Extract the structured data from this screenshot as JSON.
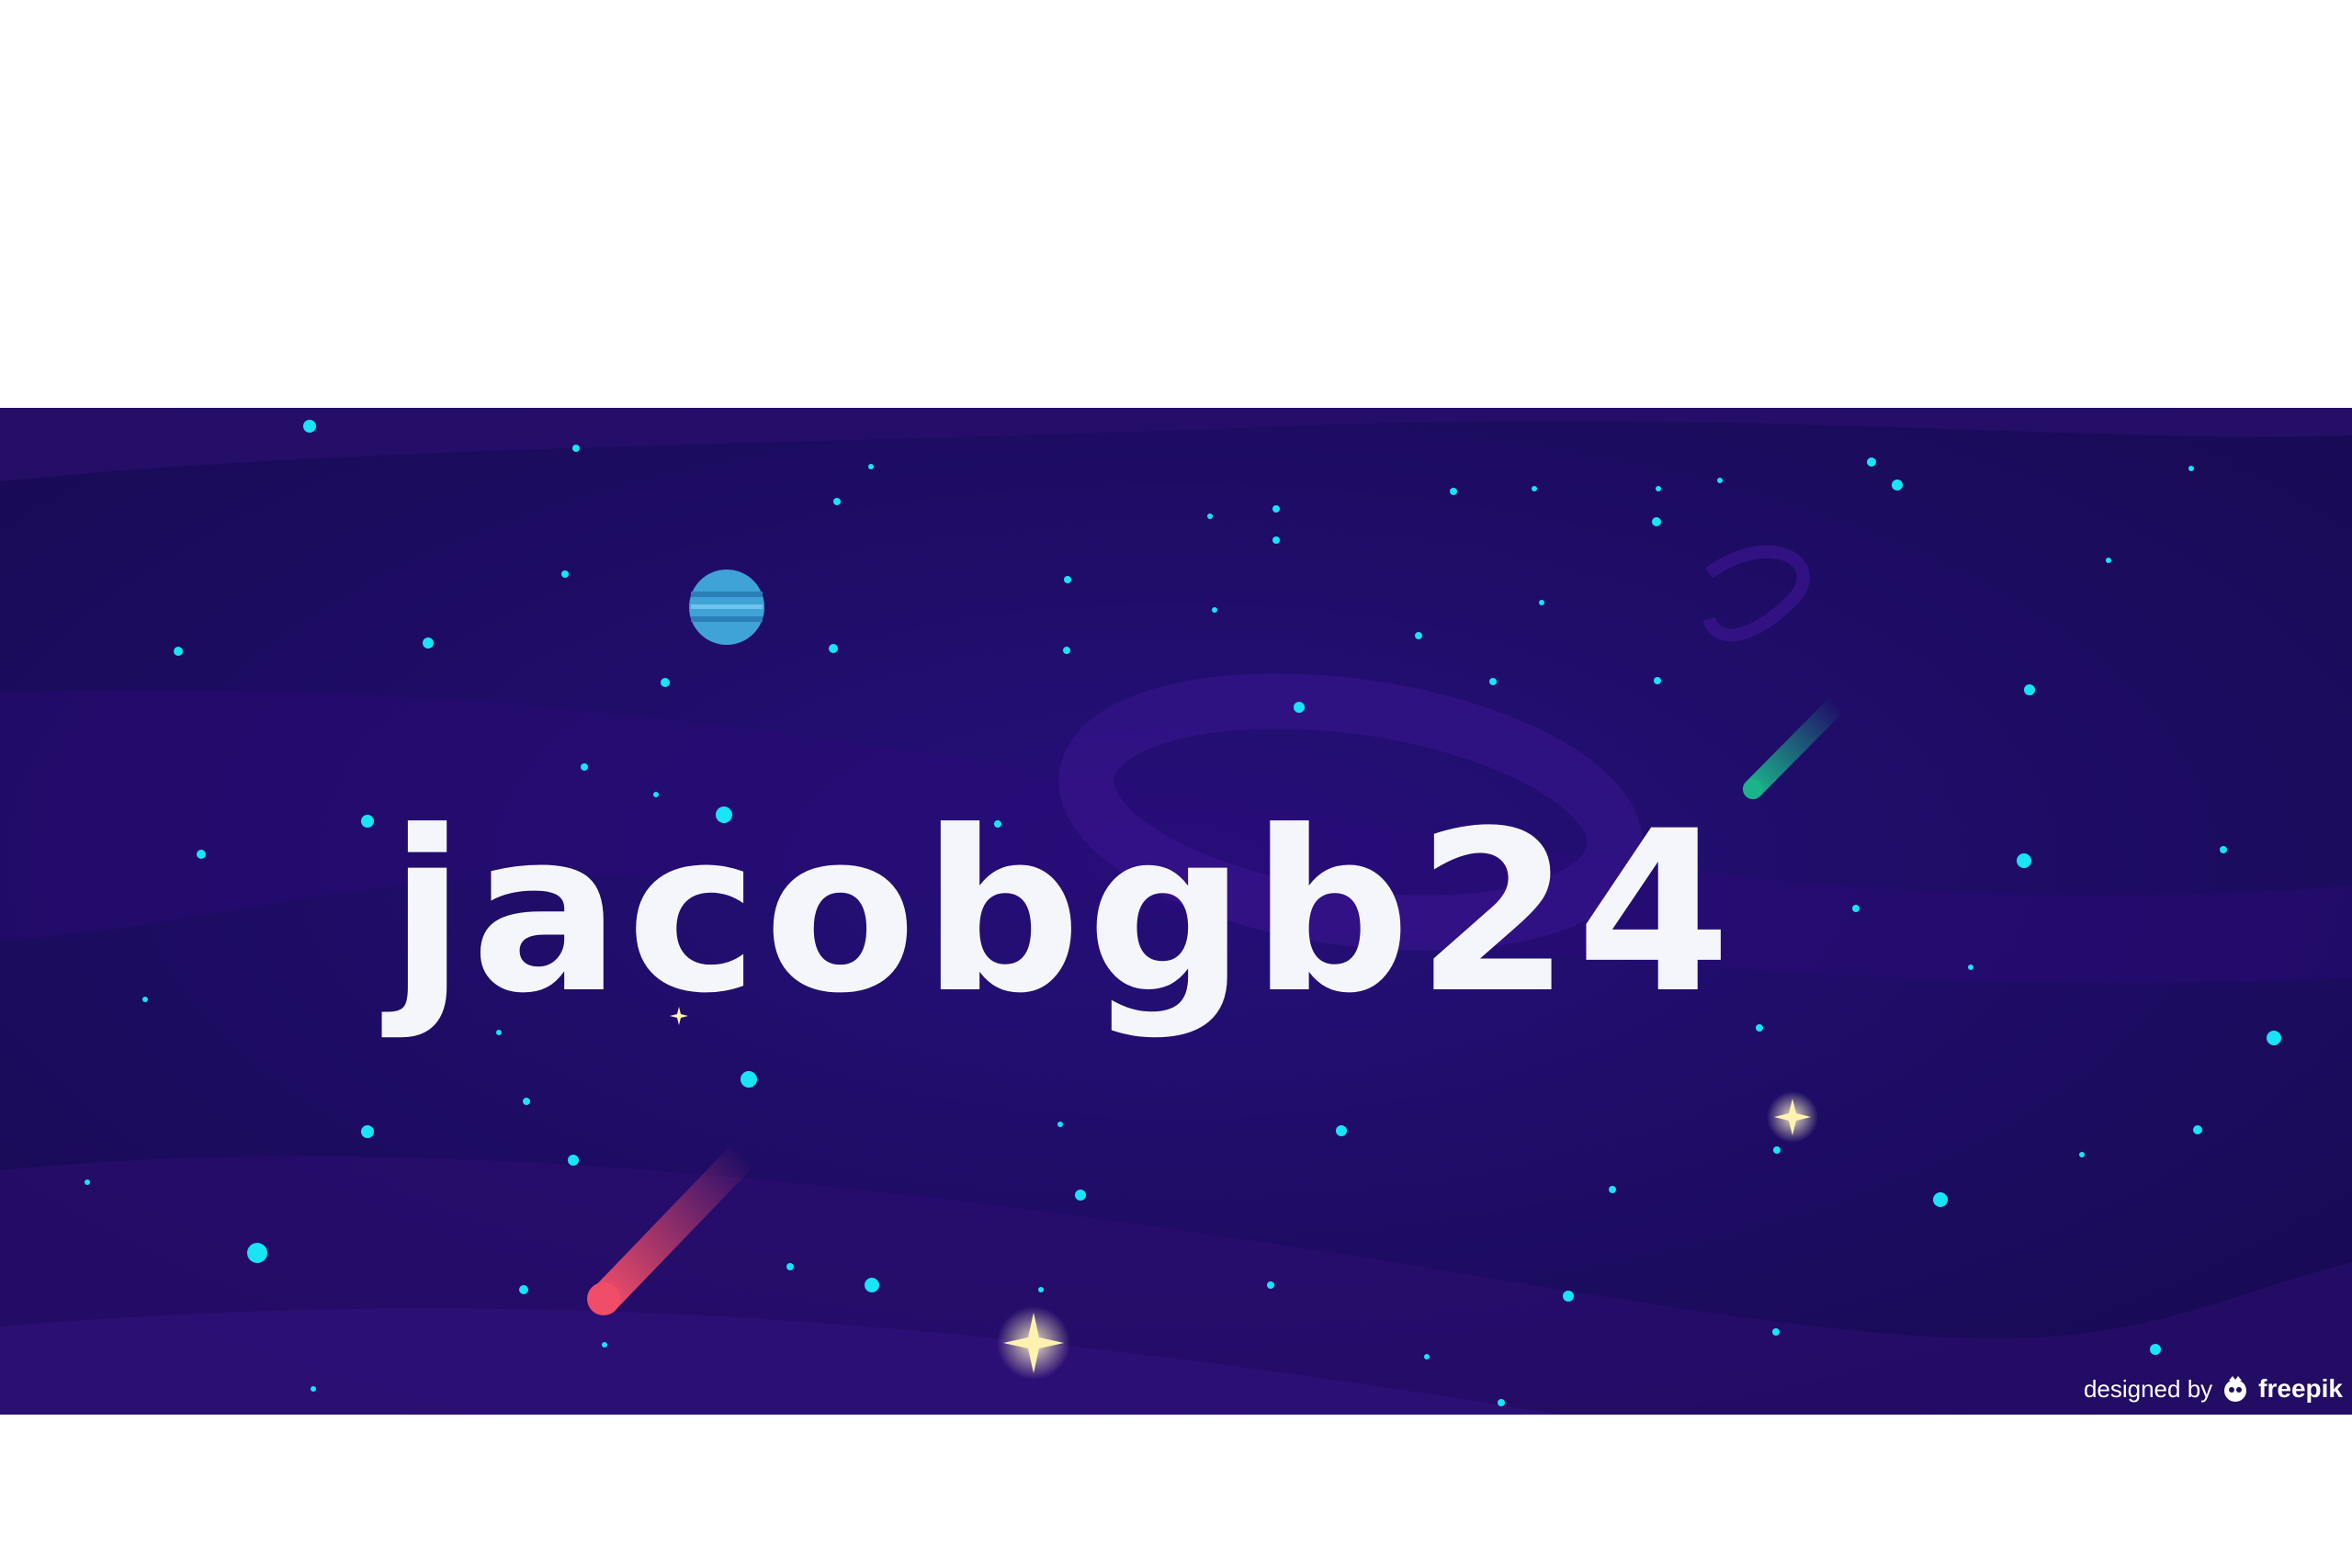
{
  "banner": {
    "username": "jacobgb24",
    "credit_prefix": "designed by",
    "credit_brand": "freepik",
    "colors": {
      "sky": "#1d0f5e",
      "star": "#18e4f5",
      "planet": "#3fa3d8",
      "comet_red": "#f04d68",
      "comet_green": "#1bb38a",
      "sparkle": "#fff2b0"
    },
    "icons": [
      "freepik-logo-icon",
      "planet-icon",
      "comet-icon",
      "sparkle-icon",
      "star-icon"
    ]
  }
}
